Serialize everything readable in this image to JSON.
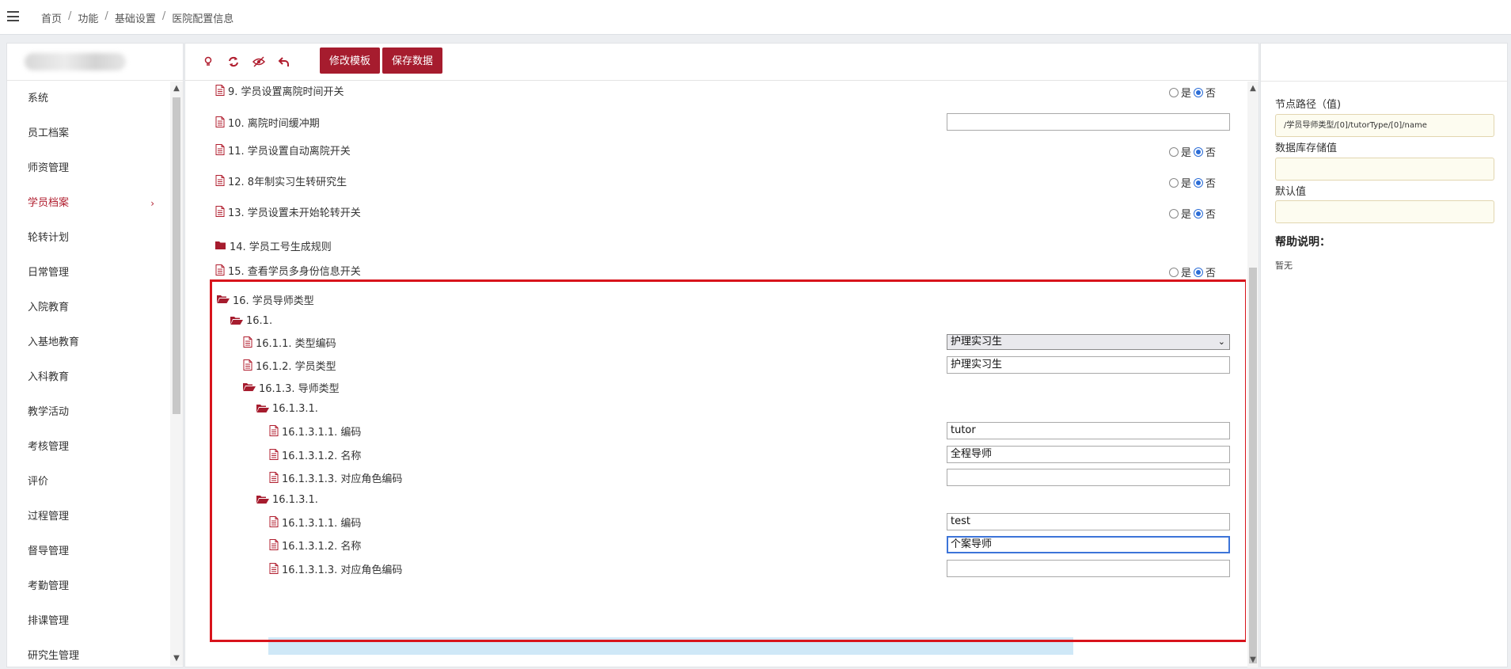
{
  "breadcrumb": [
    "首页",
    "功能",
    "基础设置",
    "医院配置信息"
  ],
  "breadcrumb_sep": "/",
  "sidebar": {
    "items": [
      {
        "label": "系统",
        "active": false
      },
      {
        "label": "员工档案",
        "active": false
      },
      {
        "label": "师资管理",
        "active": false
      },
      {
        "label": "学员档案",
        "active": true
      },
      {
        "label": "轮转计划",
        "active": false
      },
      {
        "label": "日常管理",
        "active": false
      },
      {
        "label": "入院教育",
        "active": false
      },
      {
        "label": "入基地教育",
        "active": false
      },
      {
        "label": "入科教育",
        "active": false
      },
      {
        "label": "教学活动",
        "active": false
      },
      {
        "label": "考核管理",
        "active": false
      },
      {
        "label": "评价",
        "active": false
      },
      {
        "label": "过程管理",
        "active": false
      },
      {
        "label": "督导管理",
        "active": false
      },
      {
        "label": "考勤管理",
        "active": false
      },
      {
        "label": "排课管理",
        "active": false
      },
      {
        "label": "研究生管理",
        "active": false
      }
    ],
    "active_arrow": "›"
  },
  "toolbar": {
    "icons": [
      "lightbulb-icon",
      "refresh-icon",
      "eye-slash-icon",
      "undo-icon"
    ],
    "edit_template": "修改模板",
    "save_data": "保存数据"
  },
  "radio": {
    "yes": "是",
    "no": "否"
  },
  "tree": {
    "r9": "9. 学员设置离院时间开关",
    "r10": "10. 离院时间缓冲期",
    "r11": "11. 学员设置自动离院开关",
    "r12": "12. 8年制实习生转研究生",
    "r13": "13. 学员设置未开始轮转开关",
    "r14": "14. 学员工号生成规则",
    "r15": "15. 查看学员多身份信息开关",
    "r16": "16. 学员导师类型",
    "r16_1": "16.1.",
    "r16_1_1": "16.1.1. 类型编码",
    "r16_1_1_val": "护理实习生",
    "r16_1_2": "16.1.2. 学员类型",
    "r16_1_2_val": "护理实习生",
    "r16_1_3": "16.1.3. 导师类型",
    "g1": "16.1.3.1.",
    "g1_1": "16.1.3.1.1. 编码",
    "g1_1_val": "tutor",
    "g1_2": "16.1.3.1.2. 名称",
    "g1_2_val": "全程导师",
    "g1_3": "16.1.3.1.3. 对应角色编码",
    "g1_3_val": "",
    "g2": "16.1.3.1.",
    "g2_1": "16.1.3.1.1. 编码",
    "g2_1_val": "test",
    "g2_2": "16.1.3.1.2. 名称",
    "g2_2_val": "个案导师",
    "g2_3": "16.1.3.1.3. 对应角色编码",
    "g2_3_val": ""
  },
  "right": {
    "node_path_label": "节点路径（值)",
    "node_path_value": "/学员导师类型/[0]/tutorType/[0]/name",
    "db_value_label": "数据库存储值",
    "db_value": "",
    "default_label": "默认值",
    "default_value": "",
    "help_label": "帮助说明：",
    "help_text": "暂无"
  },
  "colors": {
    "brand": "#a61c2e",
    "highlight_box": "#d8141c",
    "selected_row": "#cfe8f7"
  }
}
